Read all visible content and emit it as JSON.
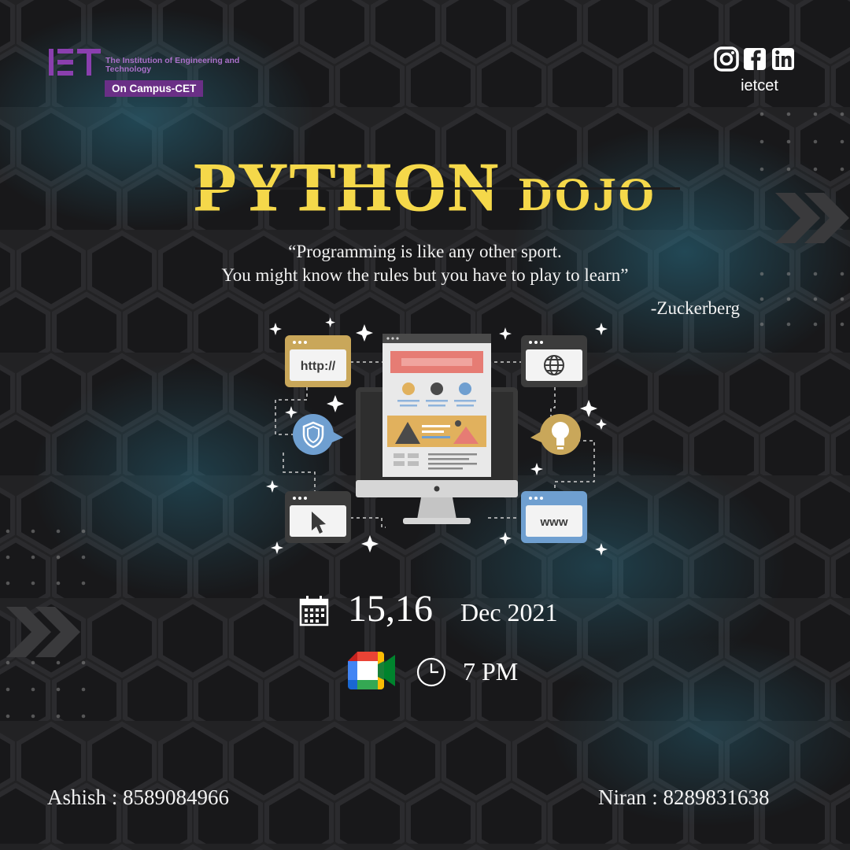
{
  "org": {
    "institution": "The Institution of Engineering and Technology",
    "campus": "On Campus-CET"
  },
  "social": {
    "icons": [
      "instagram-icon",
      "facebook-icon",
      "linkedin-icon"
    ],
    "handle": "ietcet"
  },
  "event": {
    "title_main": "PYTHON",
    "title_sub": "DOJO",
    "quote_line1": "“Programming is like any other sport.",
    "quote_line2": "You might know the rules but you have to play to learn”",
    "quote_author": "-Zuckerberg",
    "dates": "15,16",
    "month_year": "Dec 2021",
    "time": "7 PM"
  },
  "illustration": {
    "http_label": "http://",
    "www_label": "www"
  },
  "contacts": [
    {
      "text": "Ashish : 8589084966"
    },
    {
      "text": "Niran : 8289831638"
    }
  ],
  "colors": {
    "background": "#1e1e20",
    "title": "#f5d84a",
    "accent_purple": "#6a2f86",
    "hex_glow": "#2a6f86",
    "tile_gold": "#c9a75a",
    "tile_blue": "#6f9fd0",
    "tile_dark": "#3c3c3c"
  }
}
